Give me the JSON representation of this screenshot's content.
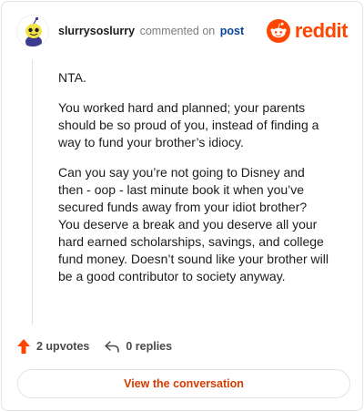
{
  "header": {
    "username": "slurrysoslurry",
    "commented_text": "commented on",
    "post_link": "post",
    "logo_text": "reddit"
  },
  "comment": {
    "paragraphs": [
      "NTA.",
      "You worked hard and planned; your parents should be so proud of you, instead of finding a way to fund your brother’s idiocy.",
      "Can you say you’re not going to Disney and then - oop - last minute book it when you’ve secured funds away from your idiot brother? You deserve a break and you deserve all your hard earned scholarships, savings, and college fund money. Doesn’t sound like your brother will be a good contributor to society anyway."
    ]
  },
  "actions": {
    "upvotes": "2 upvotes",
    "replies": "0 replies"
  },
  "footer": {
    "view_button": "View the conversation"
  },
  "colors": {
    "brand": "#ff4500",
    "link": "#0a449b",
    "button_text": "#d93a00"
  }
}
